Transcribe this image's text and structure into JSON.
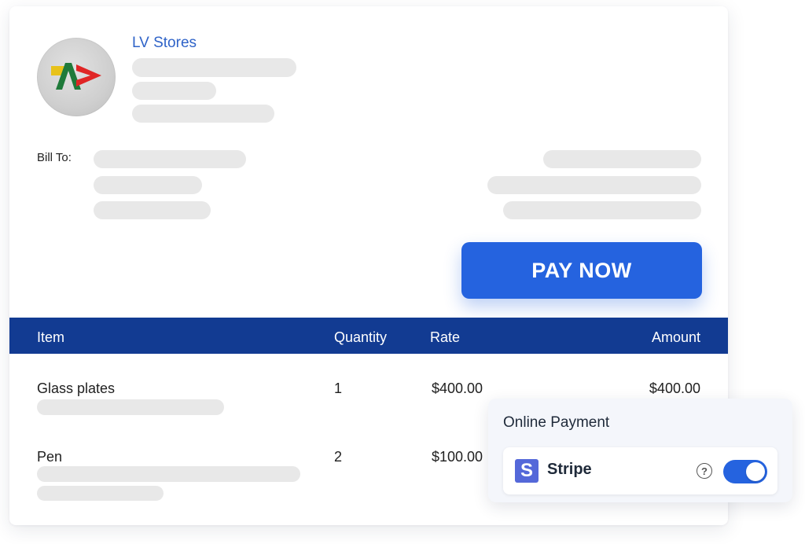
{
  "store": {
    "name": "LV Stores",
    "logo_icon": "lv-stores-logo"
  },
  "bill_to": {
    "label": "Bill To:"
  },
  "pay_button": {
    "label": "PAY NOW"
  },
  "table": {
    "columns": [
      "Item",
      "Quantity",
      "Rate",
      "Amount"
    ],
    "rows": [
      {
        "item": "Glass plates",
        "quantity": "1",
        "rate": "$400.00",
        "amount": "$400.00"
      },
      {
        "item": "Pen",
        "quantity": "2",
        "rate": "$100.00",
        "amount": ""
      }
    ]
  },
  "online_payment": {
    "title": "Online Payment",
    "provider": {
      "name": "Stripe",
      "logo_letter": "S",
      "enabled": true
    },
    "help_icon": "?"
  },
  "colors": {
    "accent": "#2563df",
    "table_header": "#123b92",
    "store_link": "#2f63c8",
    "placeholder": "#e8e8e8",
    "stripe_brand": "#5468d9"
  }
}
